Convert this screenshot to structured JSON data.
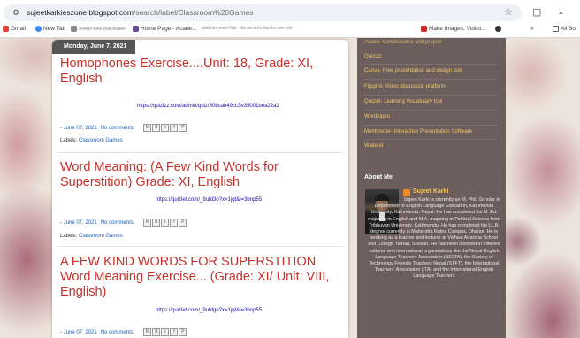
{
  "browser": {
    "url_domain": "sujeetkarkieszone.blogspot.com",
    "url_path": "/search/label/Classroom%20Games",
    "bookmarks": [
      {
        "label": "Gmail",
        "color": "#ea4335"
      },
      {
        "label": "New Tab",
        "color": "#4285f4"
      },
      {
        "label": "अनलाइन कलेज हाउस फाउंडेसन",
        "color": "#888888"
      },
      {
        "label": "Home Page - Acade...",
        "color": "#6a4c93"
      },
      {
        "label": "पदोन्नति केन्द्र संसाधन शिक्षा · लोक सेवा आयोग शिक्षा सेवा आयोग कोर्स",
        "color": "#888888"
      },
      {
        "label": "Make Images, Video...",
        "color": "#c62828"
      },
      {
        "label": "All Bo",
        "color": "#5f6368"
      }
    ]
  },
  "posts": [
    {
      "date": "Monday, June 7, 2021",
      "title": "Homophones Exercise....Unit: 18, Grade: XI, English",
      "link": "https://quizizz.com/admin/quiz/60bcab49cc3e35001bea22a2",
      "posted_date": "June 07, 2021",
      "comments": "No comments:",
      "labels_prefix": "Labels:",
      "label": "Classroom Games"
    },
    {
      "title": "Word Meaning: (A Few Kind Words for Superstition) Grade: XI, English",
      "link": "https://quizlet.com/_9ufd3o?x=1jqt&i=3bnp55",
      "posted_date": "June 07, 2021",
      "comments": "No comments:",
      "labels_prefix": "Labels:",
      "label": "Classroom Games"
    },
    {
      "title": "A FEW KIND WORDS FOR SUPERSTITION Word Meaning Exercise... (Grade: XI/ Unit: VIII, English)",
      "link": "https://quizlet.com/_9ufdge?x=1jqt&i=3bnp55",
      "posted_date": "June 07, 2021",
      "comments": "No comments:"
    }
  ],
  "share_icons": [
    "M",
    "B",
    "t",
    "f",
    "P"
  ],
  "sidebar": {
    "links": [
      "Padlet- Collaborative and project",
      "Quizizz",
      "Canva- Free presentation and design tool",
      "Flipgrid- Video discussion platform",
      "Quizlet- Learning Vocabulary tool",
      "Wordhippo",
      "Mentimeter- Interactive Presentation Software",
      "Wakelet"
    ],
    "about_title": "About Me",
    "profile_name": "Sujeet Karki",
    "bio": "Sujeet Karki is currently an M. Phil. Scholar in Department of English Language Education, Kathmandu University, Kathmandu, Nepal. He has completed his M. Ed. majoring in English and M.A. majoring in Political Science from Tribhuvan University, Kathmandu. He has completed his LL.B. degree currently in Mahendra Ratna Campus, Dharan. He is working as a teacher and lecturer at Vishwa Adarsha School and College, Itahari, Sunsari. He has been involved in different national and international organizations like the Nepal English Language Teachers Association (NELTA), the Society of Technology Friendly Teachers Nepal (STFT), the International Teachers' Association (ITA) and the International English Language Teachers"
  }
}
